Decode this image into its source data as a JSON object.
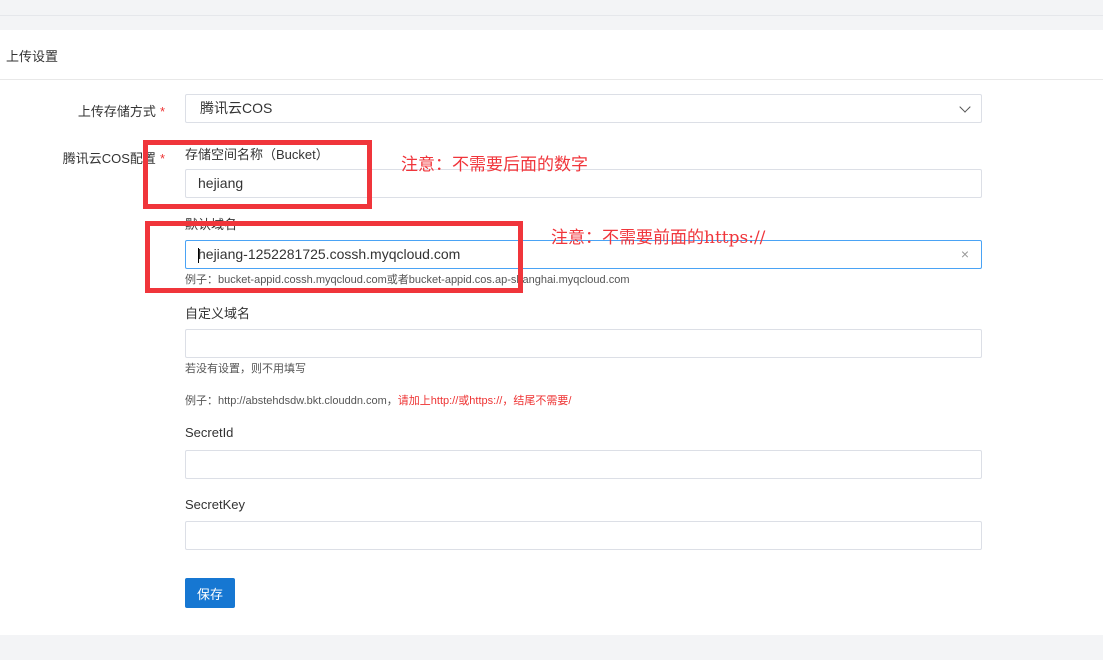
{
  "card_title": "上传设置",
  "storage_label": "上传存储方式",
  "storage_value": "腾讯云COS",
  "cos_label": "腾讯云COS配置",
  "required_mark": "*",
  "bucket_label": "存储空间名称（Bucket）",
  "bucket_value": "hejiang",
  "domain_label": "默认域名",
  "domain_value": "hejiang-1252281725.cossh.myqcloud.com",
  "domain_hint": "例子：bucket-appid.cossh.myqcloud.com或者bucket-appid.cos.ap-shanghai.myqcloud.com",
  "custom_label": "自定义域名",
  "custom_value": "",
  "custom_hint1": "若没有设置，则不用填写",
  "custom_hint2_a": "例子：http://abstehdsdw.bkt.clouddn.com，",
  "custom_hint2_b": "请加上http://或https://，结尾不需要/",
  "secretid_label": "SecretId",
  "secretid_value": "",
  "secretkey_label": "SecretKey",
  "secretkey_value": "",
  "save_label": "保存",
  "clear_icon": "×",
  "note1": "注意：不需要后面的数字",
  "note2": "注意：不需要前面的https://"
}
